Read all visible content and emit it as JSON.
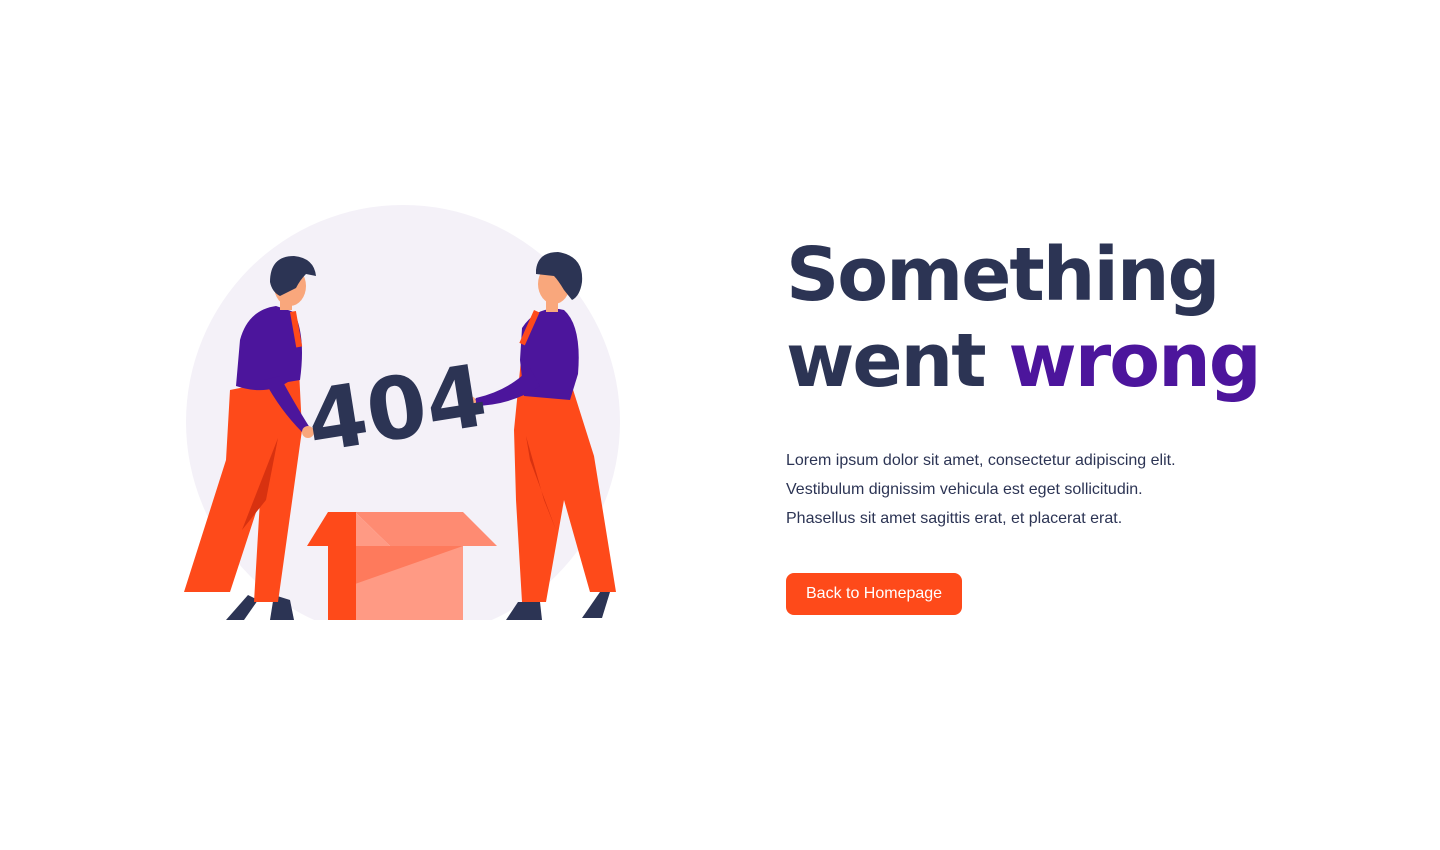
{
  "illustration": {
    "badge_text": "404"
  },
  "headline": {
    "line1": "Something",
    "line2_plain": "went",
    "line2_accent": "wrong"
  },
  "body": {
    "lines": [
      "Lorem ipsum dolor sit amet, consectetur adipiscing elit.",
      "Vestibulum dignissim vehicula est eget sollicitudin.",
      "Phasellus sit amet sagittis erat, et placerat erat."
    ]
  },
  "cta": {
    "label": "Back to Homepage"
  },
  "colors": {
    "text_dark": "#2c3454",
    "accent_purple": "#4c159c",
    "button_orange": "#fe4a1a",
    "circle_bg": "#f4f1f8",
    "box_light": "#ff9a84"
  }
}
